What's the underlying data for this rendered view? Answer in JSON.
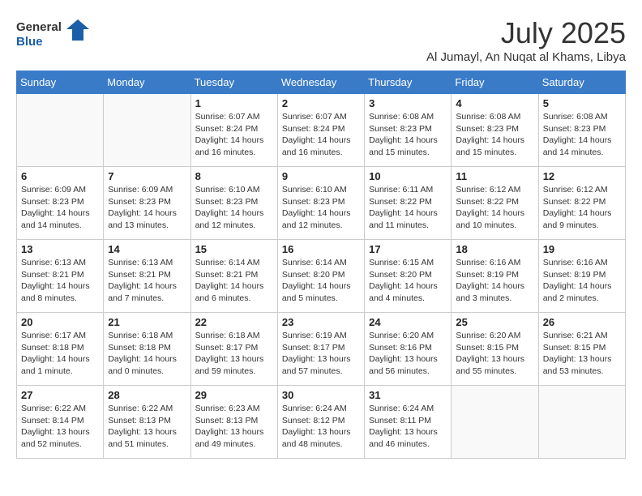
{
  "header": {
    "logo_line1": "General",
    "logo_line2": "Blue",
    "month_title": "July 2025",
    "subtitle": "Al Jumayl, An Nuqat al Khams, Libya"
  },
  "days_of_week": [
    "Sunday",
    "Monday",
    "Tuesday",
    "Wednesday",
    "Thursday",
    "Friday",
    "Saturday"
  ],
  "weeks": [
    [
      {
        "day": "",
        "info": ""
      },
      {
        "day": "",
        "info": ""
      },
      {
        "day": "1",
        "info": "Sunrise: 6:07 AM\nSunset: 8:24 PM\nDaylight: 14 hours and 16 minutes."
      },
      {
        "day": "2",
        "info": "Sunrise: 6:07 AM\nSunset: 8:24 PM\nDaylight: 14 hours and 16 minutes."
      },
      {
        "day": "3",
        "info": "Sunrise: 6:08 AM\nSunset: 8:23 PM\nDaylight: 14 hours and 15 minutes."
      },
      {
        "day": "4",
        "info": "Sunrise: 6:08 AM\nSunset: 8:23 PM\nDaylight: 14 hours and 15 minutes."
      },
      {
        "day": "5",
        "info": "Sunrise: 6:08 AM\nSunset: 8:23 PM\nDaylight: 14 hours and 14 minutes."
      }
    ],
    [
      {
        "day": "6",
        "info": "Sunrise: 6:09 AM\nSunset: 8:23 PM\nDaylight: 14 hours and 14 minutes."
      },
      {
        "day": "7",
        "info": "Sunrise: 6:09 AM\nSunset: 8:23 PM\nDaylight: 14 hours and 13 minutes."
      },
      {
        "day": "8",
        "info": "Sunrise: 6:10 AM\nSunset: 8:23 PM\nDaylight: 14 hours and 12 minutes."
      },
      {
        "day": "9",
        "info": "Sunrise: 6:10 AM\nSunset: 8:23 PM\nDaylight: 14 hours and 12 minutes."
      },
      {
        "day": "10",
        "info": "Sunrise: 6:11 AM\nSunset: 8:22 PM\nDaylight: 14 hours and 11 minutes."
      },
      {
        "day": "11",
        "info": "Sunrise: 6:12 AM\nSunset: 8:22 PM\nDaylight: 14 hours and 10 minutes."
      },
      {
        "day": "12",
        "info": "Sunrise: 6:12 AM\nSunset: 8:22 PM\nDaylight: 14 hours and 9 minutes."
      }
    ],
    [
      {
        "day": "13",
        "info": "Sunrise: 6:13 AM\nSunset: 8:21 PM\nDaylight: 14 hours and 8 minutes."
      },
      {
        "day": "14",
        "info": "Sunrise: 6:13 AM\nSunset: 8:21 PM\nDaylight: 14 hours and 7 minutes."
      },
      {
        "day": "15",
        "info": "Sunrise: 6:14 AM\nSunset: 8:21 PM\nDaylight: 14 hours and 6 minutes."
      },
      {
        "day": "16",
        "info": "Sunrise: 6:14 AM\nSunset: 8:20 PM\nDaylight: 14 hours and 5 minutes."
      },
      {
        "day": "17",
        "info": "Sunrise: 6:15 AM\nSunset: 8:20 PM\nDaylight: 14 hours and 4 minutes."
      },
      {
        "day": "18",
        "info": "Sunrise: 6:16 AM\nSunset: 8:19 PM\nDaylight: 14 hours and 3 minutes."
      },
      {
        "day": "19",
        "info": "Sunrise: 6:16 AM\nSunset: 8:19 PM\nDaylight: 14 hours and 2 minutes."
      }
    ],
    [
      {
        "day": "20",
        "info": "Sunrise: 6:17 AM\nSunset: 8:18 PM\nDaylight: 14 hours and 1 minute."
      },
      {
        "day": "21",
        "info": "Sunrise: 6:18 AM\nSunset: 8:18 PM\nDaylight: 14 hours and 0 minutes."
      },
      {
        "day": "22",
        "info": "Sunrise: 6:18 AM\nSunset: 8:17 PM\nDaylight: 13 hours and 59 minutes."
      },
      {
        "day": "23",
        "info": "Sunrise: 6:19 AM\nSunset: 8:17 PM\nDaylight: 13 hours and 57 minutes."
      },
      {
        "day": "24",
        "info": "Sunrise: 6:20 AM\nSunset: 8:16 PM\nDaylight: 13 hours and 56 minutes."
      },
      {
        "day": "25",
        "info": "Sunrise: 6:20 AM\nSunset: 8:15 PM\nDaylight: 13 hours and 55 minutes."
      },
      {
        "day": "26",
        "info": "Sunrise: 6:21 AM\nSunset: 8:15 PM\nDaylight: 13 hours and 53 minutes."
      }
    ],
    [
      {
        "day": "27",
        "info": "Sunrise: 6:22 AM\nSunset: 8:14 PM\nDaylight: 13 hours and 52 minutes."
      },
      {
        "day": "28",
        "info": "Sunrise: 6:22 AM\nSunset: 8:13 PM\nDaylight: 13 hours and 51 minutes."
      },
      {
        "day": "29",
        "info": "Sunrise: 6:23 AM\nSunset: 8:13 PM\nDaylight: 13 hours and 49 minutes."
      },
      {
        "day": "30",
        "info": "Sunrise: 6:24 AM\nSunset: 8:12 PM\nDaylight: 13 hours and 48 minutes."
      },
      {
        "day": "31",
        "info": "Sunrise: 6:24 AM\nSunset: 8:11 PM\nDaylight: 13 hours and 46 minutes."
      },
      {
        "day": "",
        "info": ""
      },
      {
        "day": "",
        "info": ""
      }
    ]
  ]
}
